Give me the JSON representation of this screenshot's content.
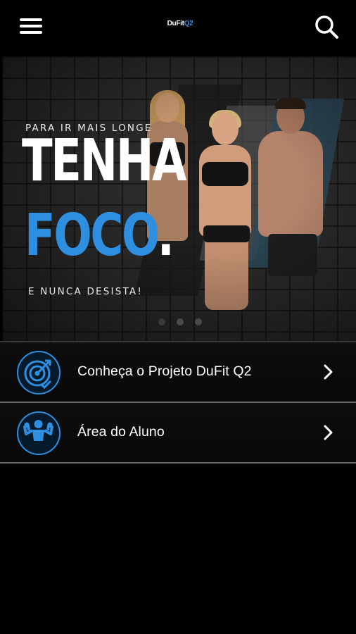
{
  "header": {
    "logo_part1": "DuFit",
    "logo_part2": "Q2",
    "menu_icon": "hamburger-menu-icon",
    "search_icon": "search-icon"
  },
  "banner": {
    "tagline_top": "PARA IR MAIS LONGE",
    "headline_1": "TENHA",
    "headline_2": "FOCO",
    "headline_2_dot": ".",
    "tagline_bottom": "E NUNCA DESISTA!",
    "slides_total": 3,
    "active_slide": 1
  },
  "menu_items": [
    {
      "label": "Conheça o Projeto DuFit Q2",
      "icon": "target-icon",
      "chevron": "chevron-right-icon"
    },
    {
      "label": "Área do Aluno",
      "icon": "muscle-icon",
      "chevron": "chevron-right-icon"
    }
  ],
  "colors": {
    "background": "#000000",
    "accent": "#2e8fe0",
    "text": "#ffffff",
    "separator": "#6a6a6a"
  }
}
